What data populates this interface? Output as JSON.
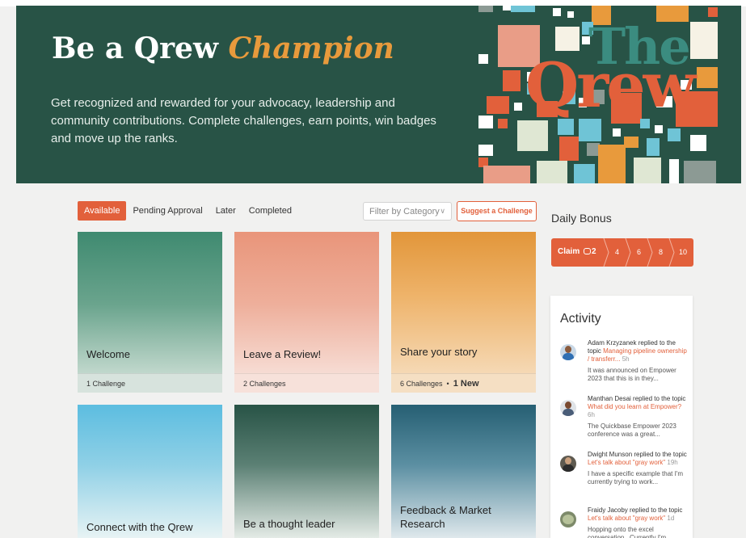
{
  "hero": {
    "title_plain": "Be a Qrew",
    "title_accent": "Champion",
    "description": "Get recognized and rewarded for your advocacy, leadership and community contributions. Complete challenges, earn points, win badges and move up the ranks.",
    "logo_the": "The",
    "logo_qrew": "Qrew"
  },
  "tabs": [
    {
      "label": "Available",
      "active": true
    },
    {
      "label": "Pending Approval",
      "active": false
    },
    {
      "label": "Later",
      "active": false
    },
    {
      "label": "Completed",
      "active": false
    }
  ],
  "filter": {
    "placeholder": "Filter by Category",
    "icon": "chevron-down-icon"
  },
  "suggest_button": "Suggest a Challenge",
  "cards": [
    {
      "title": "Welcome",
      "footer": "1 Challenge",
      "new": ""
    },
    {
      "title": "Leave a Review!",
      "footer": "2 Challenges",
      "new": ""
    },
    {
      "title": "Share your story",
      "footer": "6 Challenges",
      "new": "1 New"
    },
    {
      "title": "Connect with the Qrew",
      "footer": "",
      "new": ""
    },
    {
      "title": "Be a thought leader",
      "footer": "",
      "new": ""
    },
    {
      "title": "Feedback & Market Research",
      "footer": "",
      "new": ""
    }
  ],
  "daily_bonus": {
    "title": "Daily Bonus",
    "claim_label": "Claim",
    "claim_value": "2",
    "claim_icon": "coin-icon",
    "steps": [
      "4",
      "6",
      "8",
      "10"
    ]
  },
  "activity": {
    "title": "Activity",
    "items": [
      {
        "user": "Adam Krzyzanek",
        "action": "replied to the topic",
        "topic": "Managing pipeline ownership / transferr...",
        "time": "5h",
        "excerpt": "It was announced on Empower 2023 that this is in they..."
      },
      {
        "user": "Manthan Desai",
        "action": "replied to the topic",
        "topic": "What did you learn at Empower?",
        "time": "6h",
        "excerpt": "The Quickbase Empower 2023 conference was a great..."
      },
      {
        "user": "Dwight Munson",
        "action": "replied to the topic",
        "topic": "Let's talk about \"gray work\"",
        "time": "19h",
        "excerpt": "I have a specific example that I'm currently trying to work..."
      },
      {
        "user": "Fraidy Jacoby",
        "action": "replied to the topic",
        "topic": "Let's talk about \"gray work\"",
        "time": "1d",
        "excerpt": "Hopping onto the excel conversation . Currently I'm..."
      }
    ]
  },
  "colors": {
    "accent": "#e2603b",
    "hero_bg": "#285346",
    "champion": "#e89a3c"
  }
}
